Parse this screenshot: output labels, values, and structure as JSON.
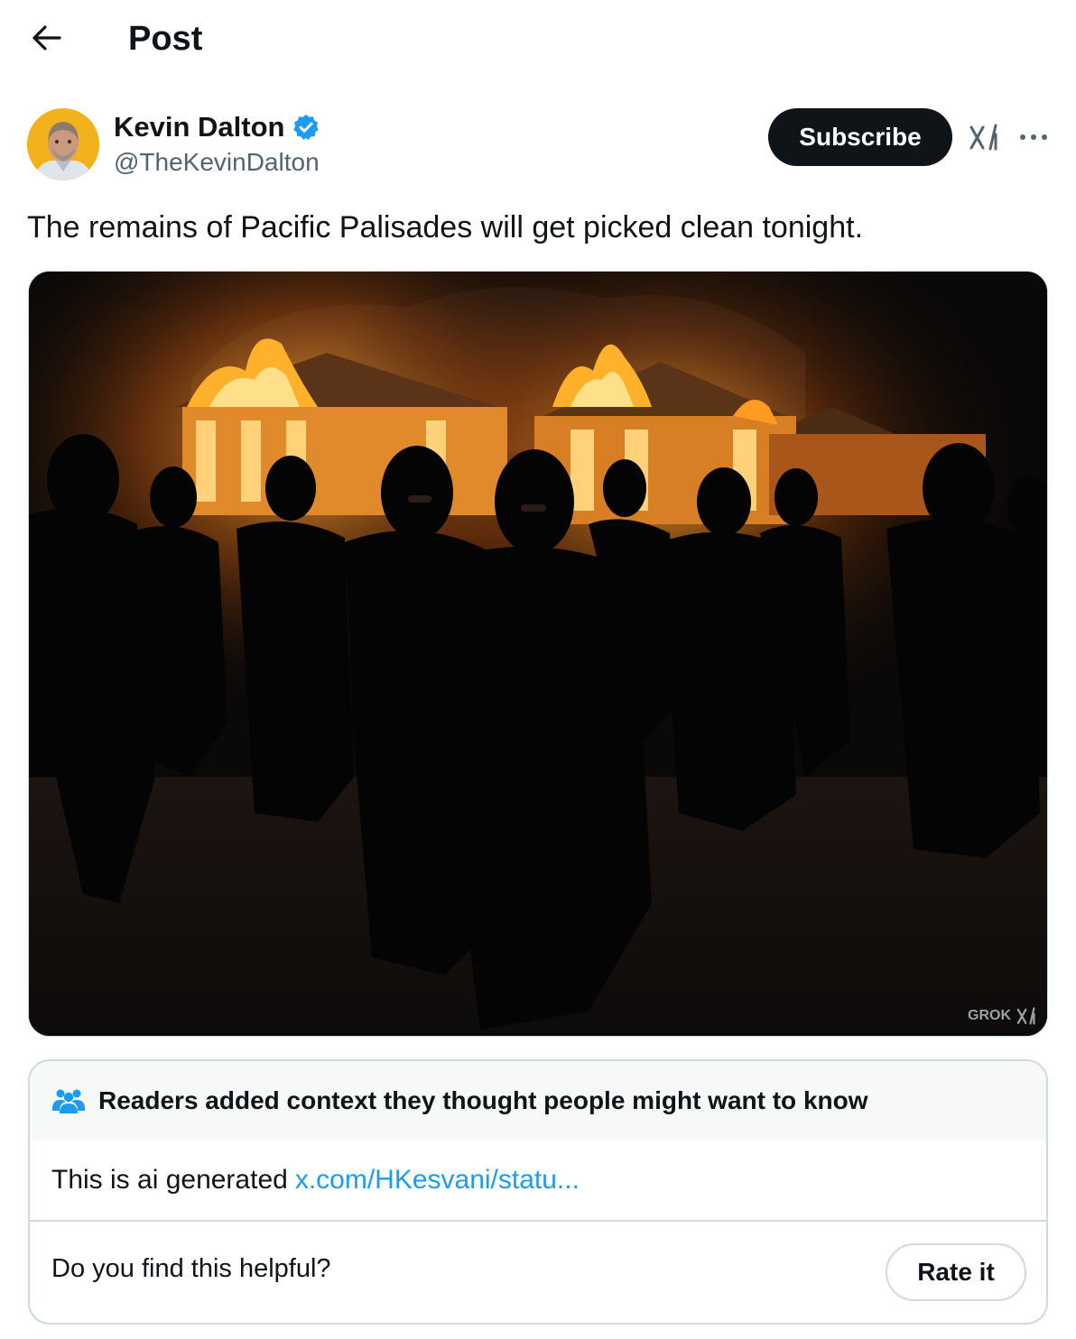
{
  "header": {
    "title": "Post",
    "back_icon": "arrow-left-icon"
  },
  "post": {
    "author": {
      "name": "Kevin Dalton",
      "handle": "@TheKevinDalton",
      "verified": true,
      "verified_color": "#1d9bf0"
    },
    "subscribe_label": "Subscribe",
    "grok_icon": "grok-icon",
    "more_icon": "more-horizontal-icon",
    "text": "The remains of Pacific Palisades will get picked clean tonight.",
    "media": {
      "watermark": "GROK"
    }
  },
  "community_note": {
    "title": "Readers added context they thought people might want to know",
    "body_text": "This is ai generated",
    "link_text": "x.com/HKesvani/statu...",
    "link_color": "#1d9bf0",
    "helpful_question": "Do you find this helpful?",
    "rate_label": "Rate it"
  }
}
